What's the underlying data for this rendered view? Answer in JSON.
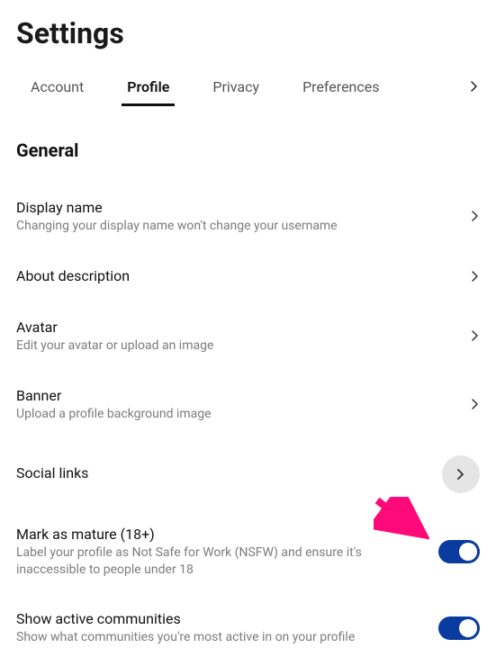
{
  "page": {
    "title": "Settings"
  },
  "tabs": {
    "items": [
      {
        "label": "Account"
      },
      {
        "label": "Profile",
        "active": true
      },
      {
        "label": "Privacy"
      },
      {
        "label": "Preferences"
      }
    ]
  },
  "section": {
    "general_title": "General"
  },
  "settings": {
    "display_name": {
      "label": "Display name",
      "desc": "Changing your display name won't change your username"
    },
    "about": {
      "label": "About description"
    },
    "avatar": {
      "label": "Avatar",
      "desc": "Edit your avatar or upload an image"
    },
    "banner": {
      "label": "Banner",
      "desc": "Upload a profile background image"
    },
    "social_links": {
      "label": "Social links"
    },
    "mark_mature": {
      "label": "Mark as mature (18+)",
      "desc": "Label your profile as Not Safe for Work (NSFW) and ensure it's inaccessible to people under 18",
      "enabled": true
    },
    "active_communities": {
      "label": "Show active communities",
      "desc": "Show what communities you're most active in on your profile",
      "enabled": true
    }
  }
}
